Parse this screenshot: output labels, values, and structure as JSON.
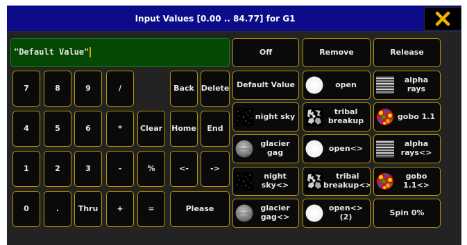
{
  "window": {
    "title": "Input Values [0.00 .. 84.77] for G1"
  },
  "input": {
    "value": "\"Default Value\""
  },
  "keypad": {
    "k7": "7",
    "k8": "8",
    "k9": "9",
    "slash": "/",
    "back": "Back",
    "delete": "Delete",
    "k4": "4",
    "k5": "5",
    "k6": "6",
    "star": "*",
    "clear": "Clear",
    "home": "Home",
    "end": "End",
    "k1": "1",
    "k2": "2",
    "k3": "3",
    "minus": "-",
    "percent": "%",
    "left": "<-",
    "right": "->",
    "k0": "0",
    "dot": ".",
    "thru": "Thru",
    "plus": "+",
    "equals": "=",
    "please": "Please"
  },
  "presets": {
    "off": "Off",
    "remove": "Remove",
    "release": "Release",
    "default_value": "Default Value",
    "open": "open",
    "alpha_rays": "alpha rays",
    "night_sky": "night sky",
    "tribal_breakup": "tribal breakup",
    "gobo_1_1": "gobo 1.1",
    "glacier_gag": "glacier gag",
    "open_cycle": "open<>",
    "alpha_rays_cycle": "alpha rays<>",
    "night_sky_cycle": "night sky<>",
    "tribal_breakup_cycle": "tribal breakup<>",
    "gobo_1_1_cycle": "gobo 1.1<>",
    "glacier_gag_cycle": "glacier gag<>",
    "open_cycle_2": "open<> (2)",
    "spin_0": "Spin 0%"
  },
  "icons": {
    "close": "close-x-icon",
    "night_sky": "night-sky-gobo-icon",
    "tribal": "tribal-gobo-icon",
    "glacier": "glacier-gobo-icon",
    "open": "open-circle-gobo-icon",
    "alpha_rays": "alpha-rays-gobo-icon",
    "gobo_1_1": "color-dots-gobo-icon"
  },
  "colors": {
    "title_bar": "#0c0c8a",
    "close_x": "#f0b000",
    "button_border": "#b89600",
    "input_bg": "#044804",
    "caret": "#d9a000",
    "panel_bg": "#232323"
  }
}
